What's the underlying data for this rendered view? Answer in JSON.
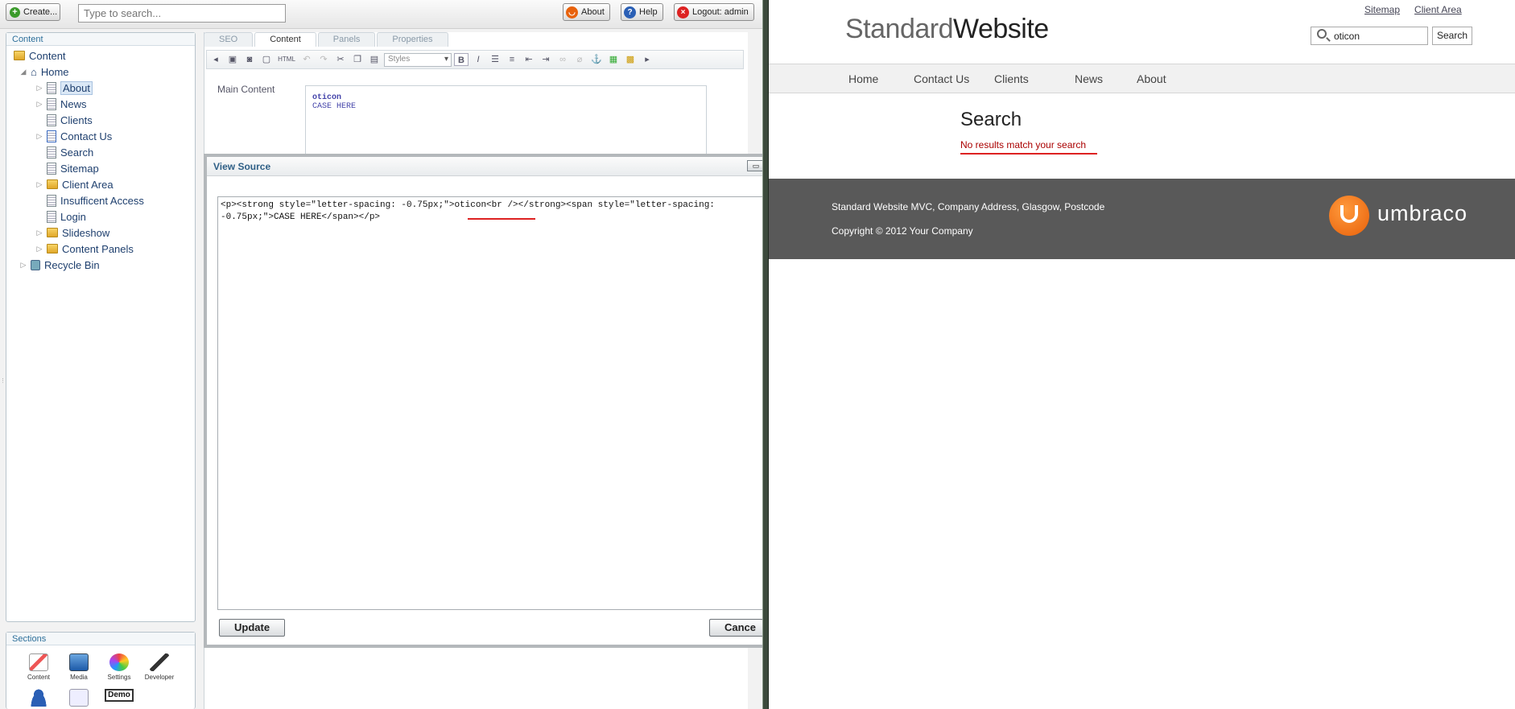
{
  "topbar": {
    "create_label": "Create...",
    "search_placeholder": "Type to search...",
    "about_label": "About",
    "help_label": "Help",
    "logout_label": "Logout: admin"
  },
  "content_panel": {
    "title": "Content",
    "tree": [
      {
        "label": "Content"
      },
      {
        "label": "Home"
      },
      {
        "label": "About"
      },
      {
        "label": "News"
      },
      {
        "label": "Clients"
      },
      {
        "label": "Contact Us"
      },
      {
        "label": "Search"
      },
      {
        "label": "Sitemap"
      },
      {
        "label": "Client Area"
      },
      {
        "label": "Insufficent Access"
      },
      {
        "label": "Login"
      },
      {
        "label": "Slideshow"
      },
      {
        "label": "Content Panels"
      },
      {
        "label": "Recycle Bin"
      }
    ]
  },
  "sections_panel": {
    "title": "Sections",
    "items": [
      {
        "label": "Content"
      },
      {
        "label": "Media"
      },
      {
        "label": "Settings"
      },
      {
        "label": "Developer"
      }
    ],
    "demo_label": "Demo"
  },
  "editor": {
    "tabs": [
      "SEO",
      "Content",
      "Panels",
      "Properties"
    ],
    "toolbar_styles": "Styles",
    "toolbar_html": "HTML",
    "main_content_label": "Main Content",
    "main_content_lines": [
      "oticon",
      "CASE HERE"
    ]
  },
  "view_source": {
    "title": "View Source",
    "line1": "<p><strong style=\"letter-spacing: -0.75px;\">oticon<br /></strong><span style=\"letter-spacing:",
    "line2": "-0.75px;\">CASE HERE</span></p>",
    "update_label": "Update",
    "cancel_label": "Cance"
  },
  "site": {
    "logo_part1": "Standard",
    "logo_part2": "Website",
    "top_links": [
      "Sitemap",
      "Client Area"
    ],
    "search_value": "oticon",
    "search_button": "Search",
    "nav": [
      "Home",
      "Contact Us",
      "Clients",
      "News",
      "About"
    ],
    "heading": "Search",
    "no_results": "No results match your search",
    "footer_address": "Standard Website MVC, Company Address, Glasgow, Postcode",
    "footer_copyright": "Copyright © 2012 Your Company",
    "brand": "umbraco"
  },
  "colors": {
    "accent_red": "#d22222",
    "footer_bg": "#595959",
    "umbraco_orange": "#f07518"
  }
}
